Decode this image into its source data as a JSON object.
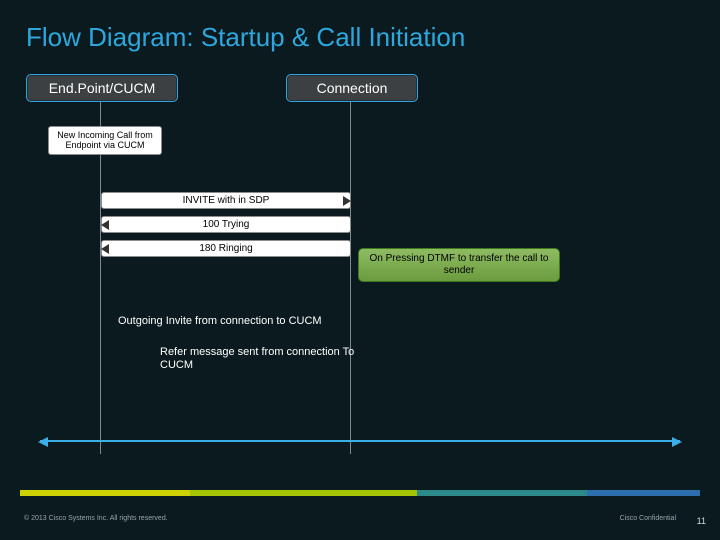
{
  "title": "Flow Diagram: Startup & Call Initiation",
  "participants": {
    "left": "End.Point/CUCM",
    "right": "Connection"
  },
  "events": {
    "new_call": "New Incoming Call from Endpoint via CUCM"
  },
  "messages": {
    "invite": "INVITE with in SDP",
    "trying": "100 Trying",
    "ringing": "180 Ringing",
    "dtmf_note": "On Pressing DTMF to transfer the call to sender",
    "outgoing": "Outgoing Invite from connection to CUCM",
    "refer": "Refer message sent from connection To CUCM"
  },
  "footer": {
    "copyright": "© 2013 Cisco Systems Inc. All rights reserved.",
    "confidential": "Cisco Confidential",
    "page": "11"
  }
}
